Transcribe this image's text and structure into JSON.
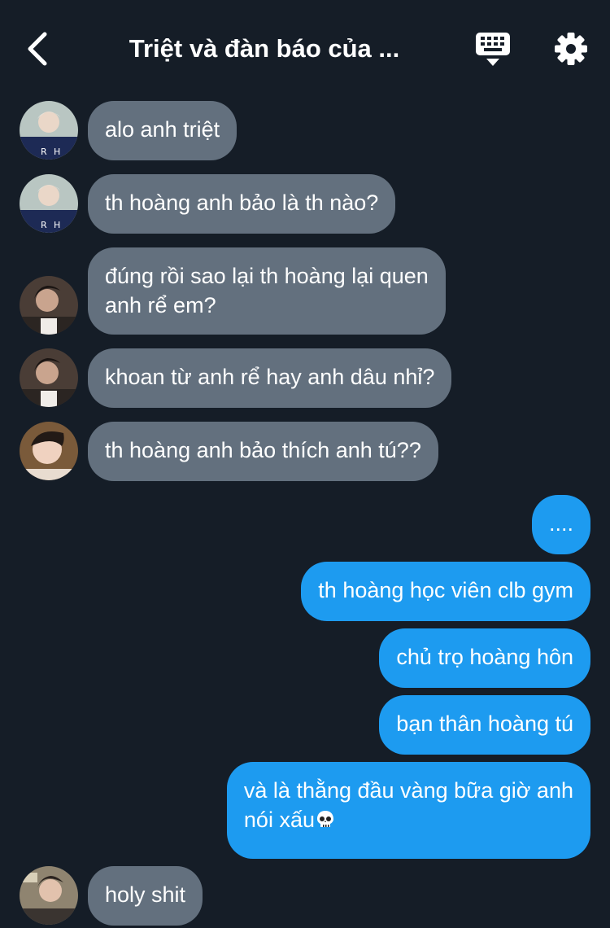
{
  "header": {
    "title": "Triệt và đàn báo của ..."
  },
  "icons": {
    "back": "chevron-left-icon",
    "keyboard": "keyboard-icon",
    "settings": "gear-icon",
    "skull": "skull-emoji"
  },
  "messages": [
    {
      "side": "in",
      "avatar": "avatar-1",
      "lines": [
        "alo anh triệt"
      ]
    },
    {
      "side": "in",
      "avatar": "avatar-1",
      "lines": [
        "th hoàng anh bảo là th nào?"
      ]
    },
    {
      "side": "in",
      "avatar": "avatar-2",
      "lines": [
        "đúng rồi sao lại th hoàng lại quen",
        "anh rể em?"
      ]
    },
    {
      "side": "in",
      "avatar": "avatar-2",
      "lines": [
        "khoan từ anh rể hay anh dâu nhỉ?"
      ]
    },
    {
      "side": "in",
      "avatar": "avatar-3",
      "lines": [
        "th hoàng anh bảo thích anh tú??"
      ]
    },
    {
      "side": "out",
      "lines": [
        "...."
      ]
    },
    {
      "side": "out",
      "lines": [
        "th hoàng học viên clb gym"
      ]
    },
    {
      "side": "out",
      "lines": [
        "chủ trọ hoàng hôn"
      ]
    },
    {
      "side": "out",
      "lines": [
        "bạn thân hoàng tú"
      ]
    },
    {
      "side": "out",
      "lines": [
        "và là thằng đầu vàng bữa giờ anh",
        "nói xấu"
      ]
    },
    {
      "side": "in",
      "avatar": "avatar-4",
      "lines": [
        "holy shit"
      ]
    }
  ],
  "colors": {
    "background": "#151d27",
    "incoming_bubble": "#63707e",
    "outgoing_bubble": "#1d9bf0"
  }
}
